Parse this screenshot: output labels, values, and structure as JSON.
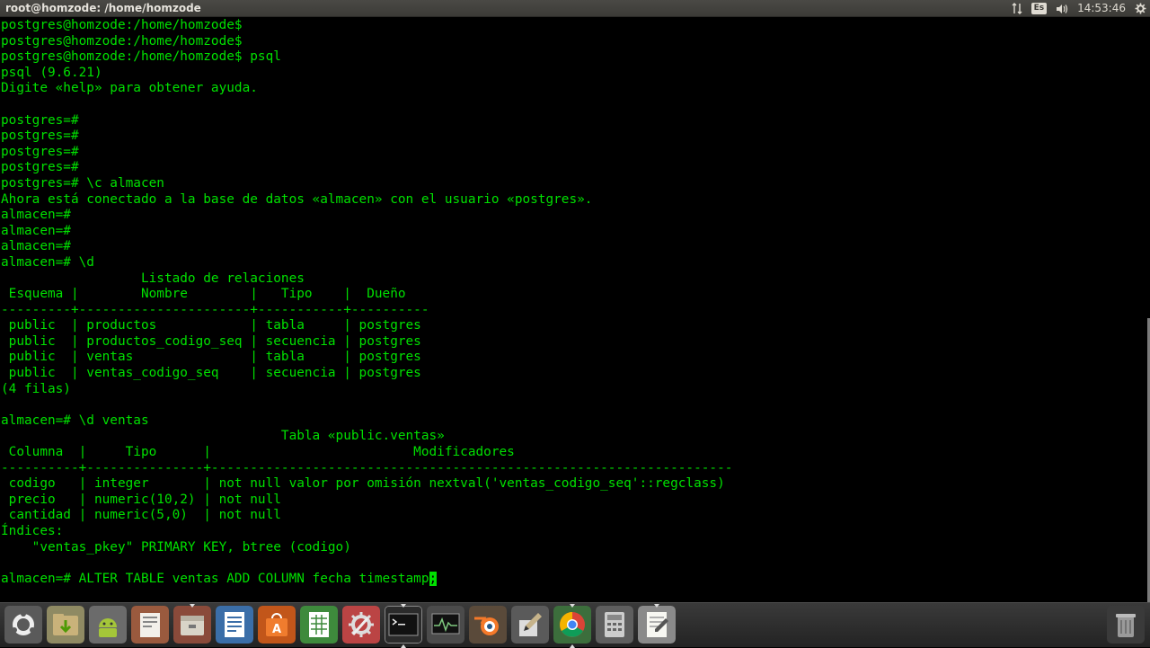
{
  "top_panel": {
    "window_title": "root@homzode: /home/homzode",
    "keyboard_layout": "Es",
    "time": "14:53:46",
    "icons": [
      "network-arrows-icon",
      "keyboard-layout-icon",
      "volume-icon",
      "settings-gear-icon"
    ]
  },
  "terminal": {
    "lines": [
      "postgres@homzode:/home/homzode$",
      "postgres@homzode:/home/homzode$",
      "postgres@homzode:/home/homzode$ psql",
      "psql (9.6.21)",
      "Digite «help» para obtener ayuda.",
      "",
      "postgres=#",
      "postgres=#",
      "postgres=#",
      "postgres=#",
      "postgres=# \\c almacen",
      "Ahora está conectado a la base de datos «almacen» con el usuario «postgres».",
      "almacen=#",
      "almacen=#",
      "almacen=#",
      "almacen=# \\d",
      "                  Listado de relaciones",
      " Esquema |        Nombre        |   Tipo    |  Dueño",
      "---------+----------------------+-----------+----------",
      " public  | productos            | tabla     | postgres",
      " public  | productos_codigo_seq | secuencia | postgres",
      " public  | ventas               | tabla     | postgres",
      " public  | ventas_codigo_seq    | secuencia | postgres",
      "(4 filas)",
      "",
      "almacen=# \\d ventas",
      "                                    Tabla «public.ventas»",
      " Columna  |     Tipo      |                          Modificadores",
      "----------+---------------+-------------------------------------------------------------------",
      " codigo   | integer       | not null valor por omisión nextval('ventas_codigo_seq'::regclass)",
      " precio   | numeric(10,2) | not null",
      " cantidad | numeric(5,0)  | not null",
      "Índices:",
      "    \"ventas_pkey\" PRIMARY KEY, btree (codigo)",
      "",
      "almacen=# ALTER TABLE ventas ADD COLUMN fecha timestamp"
    ],
    "cursor_char": ";",
    "text_color": "#00e000",
    "background_color": "#000000"
  },
  "dock": {
    "apps": [
      "ubuntu-logo-icon",
      "files-icon",
      "android-studio-icon",
      "document-viewer-icon",
      "archive-manager-icon",
      "writer-icon",
      "app-installer-icon",
      "calc-icon",
      "system-settings-icon",
      "terminal-icon",
      "system-monitor-icon",
      "blender-icon",
      "paint-icon",
      "chrome-icon",
      "calculator-icon",
      "text-editor-icon",
      "trash-icon"
    ]
  }
}
